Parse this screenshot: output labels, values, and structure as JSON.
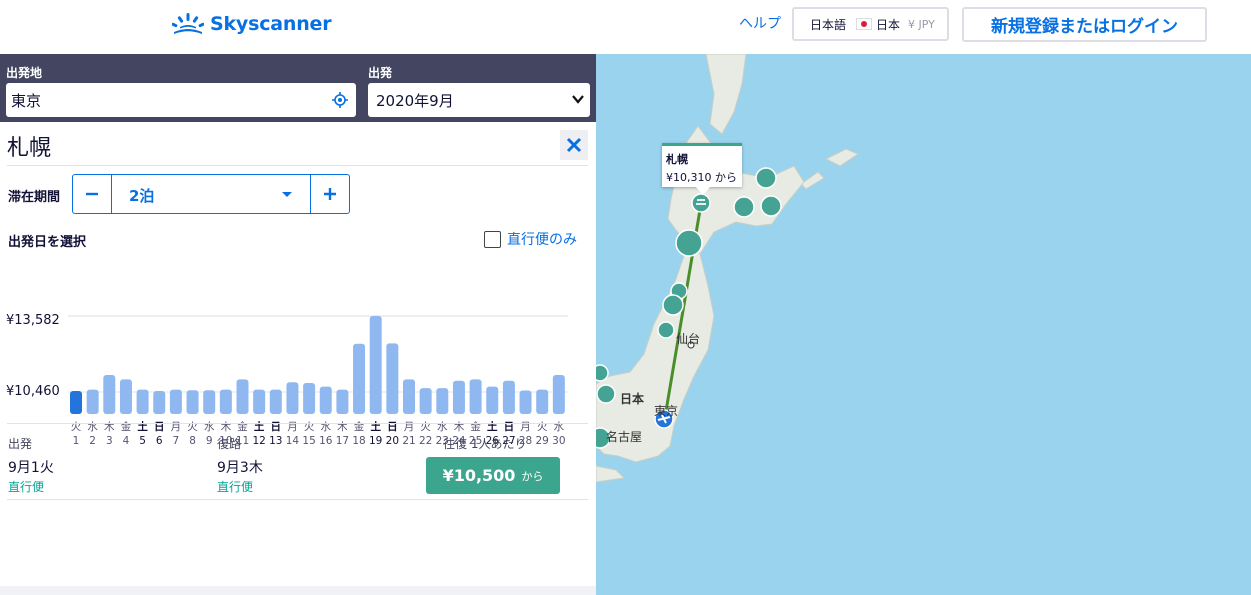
{
  "header": {
    "logo_text": "Skyscanner",
    "help": "ヘルプ",
    "locale": {
      "language": "日本語",
      "country": "日本",
      "currency": "¥ JPY"
    },
    "login": "新規登録またはログイン"
  },
  "search": {
    "origin_label": "出発地",
    "origin_value": "東京",
    "depart_label": "出発",
    "depart_value": "2020年9月"
  },
  "destination": {
    "title": "札幌"
  },
  "stay": {
    "label": "滞在期間",
    "value": "2泊"
  },
  "date_select": {
    "label": "出発日を選択",
    "direct_only": "直行便のみ",
    "direct_only_checked": false
  },
  "chart_data": {
    "type": "bar",
    "y_ticks": [
      "¥13,582",
      "¥10,460"
    ],
    "ylim": [
      10460,
      13582
    ],
    "selected_index": 0,
    "colors": {
      "selected": "#2474db",
      "default": "#8fb8f0"
    },
    "categories": [
      {
        "day": "火",
        "date": "1",
        "bold": false
      },
      {
        "day": "水",
        "date": "2",
        "bold": false
      },
      {
        "day": "木",
        "date": "3",
        "bold": false
      },
      {
        "day": "金",
        "date": "4",
        "bold": false
      },
      {
        "day": "土",
        "date": "5",
        "bold": true
      },
      {
        "day": "日",
        "date": "6",
        "bold": true
      },
      {
        "day": "月",
        "date": "7",
        "bold": false
      },
      {
        "day": "火",
        "date": "8",
        "bold": false
      },
      {
        "day": "水",
        "date": "9",
        "bold": false
      },
      {
        "day": "木",
        "date": "10",
        "bold": false
      },
      {
        "day": "金",
        "date": "11",
        "bold": false
      },
      {
        "day": "土",
        "date": "12",
        "bold": true
      },
      {
        "day": "日",
        "date": "13",
        "bold": true
      },
      {
        "day": "月",
        "date": "14",
        "bold": false
      },
      {
        "day": "火",
        "date": "15",
        "bold": false
      },
      {
        "day": "水",
        "date": "16",
        "bold": false
      },
      {
        "day": "木",
        "date": "17",
        "bold": false
      },
      {
        "day": "金",
        "date": "18",
        "bold": false
      },
      {
        "day": "土",
        "date": "19",
        "bold": true
      },
      {
        "day": "日",
        "date": "20",
        "bold": true
      },
      {
        "day": "月",
        "date": "21",
        "bold": false
      },
      {
        "day": "火",
        "date": "22",
        "bold": false
      },
      {
        "day": "水",
        "date": "23",
        "bold": false
      },
      {
        "day": "木",
        "date": "24",
        "bold": false
      },
      {
        "day": "金",
        "date": "25",
        "bold": false
      },
      {
        "day": "土",
        "date": "26",
        "bold": true
      },
      {
        "day": "日",
        "date": "27",
        "bold": true
      },
      {
        "day": "月",
        "date": "28",
        "bold": false
      },
      {
        "day": "火",
        "date": "29",
        "bold": false
      },
      {
        "day": "水",
        "date": "30",
        "bold": false
      }
    ],
    "values": [
      10500,
      10560,
      11160,
      10980,
      10560,
      10500,
      10560,
      10530,
      10530,
      10560,
      10980,
      10560,
      10560,
      10860,
      10830,
      10680,
      10560,
      12440,
      13582,
      12460,
      10980,
      10620,
      10620,
      10920,
      10980,
      10680,
      10920,
      10520,
      10560,
      11160
    ]
  },
  "summary": {
    "outbound_label": "出発",
    "outbound_date": "9月1火",
    "outbound_type": "直行便",
    "return_label": "復路",
    "return_date": "9月3木",
    "return_type": "直行便",
    "price_label": "往復 1人あたり",
    "price": "¥10,500",
    "price_suffix": "から"
  },
  "map": {
    "tooltip_city": "札幌",
    "tooltip_price": "¥10,310 から",
    "labels": {
      "sendai": "仙台",
      "japan": "日本",
      "tokyo": "東京",
      "nagoya": "名古屋"
    },
    "colors": {
      "sea": "#9ad3ee",
      "land": "#e8ebe3",
      "route": "#4a8e2a",
      "marker": "#45a394"
    }
  }
}
